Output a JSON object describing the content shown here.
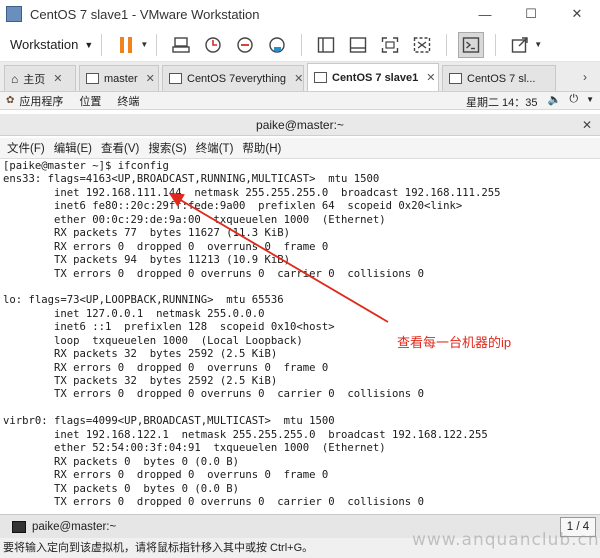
{
  "window": {
    "title": "CentOS 7  slave1 - VMware Workstation",
    "minimize": "—",
    "maximize": "☐",
    "close": "✕"
  },
  "toolbar": {
    "workstation_label": "Workstation"
  },
  "tabs": [
    {
      "label": "主页",
      "icon": "home-icon"
    },
    {
      "label": "master",
      "icon": "vm-icon"
    },
    {
      "label": "CentOS 7everything",
      "icon": "vm-icon"
    },
    {
      "label": "CentOS 7  slave1",
      "icon": "vm-icon",
      "active": true
    },
    {
      "label": "CentOS 7 sl...",
      "icon": "vm-icon"
    }
  ],
  "gnome": {
    "apps": "应用程序",
    "places": "位置",
    "terminal": "终端",
    "clock": "星期二 14：35"
  },
  "terminal": {
    "title": "paike@master:~",
    "menu": [
      "文件(F)",
      "编辑(E)",
      "查看(V)",
      "搜索(S)",
      "终端(T)",
      "帮助(H)"
    ],
    "lines": [
      "[paike@master ~]$ ifconfig",
      "ens33: flags=4163<UP,BROADCAST,RUNNING,MULTICAST>  mtu 1500",
      "        inet 192.168.111.144  netmask 255.255.255.0  broadcast 192.168.111.255",
      "        inet6 fe80::20c:29ff:fede:9a00  prefixlen 64  scopeid 0x20<link>",
      "        ether 00:0c:29:de:9a:00  txqueuelen 1000  (Ethernet)",
      "        RX packets 77  bytes 11627 (11.3 KiB)",
      "        RX errors 0  dropped 0  overruns 0  frame 0",
      "        TX packets 94  bytes 11213 (10.9 KiB)",
      "        TX errors 0  dropped 0 overruns 0  carrier 0  collisions 0",
      "",
      "lo: flags=73<UP,LOOPBACK,RUNNING>  mtu 65536",
      "        inet 127.0.0.1  netmask 255.0.0.0",
      "        inet6 ::1  prefixlen 128  scopeid 0x10<host>",
      "        loop  txqueuelen 1000  (Local Loopback)",
      "        RX packets 32  bytes 2592 (2.5 KiB)",
      "        RX errors 0  dropped 0  overruns 0  frame 0",
      "        TX packets 32  bytes 2592 (2.5 KiB)",
      "        TX errors 0  dropped 0 overruns 0  carrier 0  collisions 0",
      "",
      "virbr0: flags=4099<UP,BROADCAST,MULTICAST>  mtu 1500",
      "        inet 192.168.122.1  netmask 255.255.255.0  broadcast 192.168.122.255",
      "        ether 52:54:00:3f:04:91  txqueuelen 1000  (Ethernet)",
      "        RX packets 0  bytes 0 (0.0 B)",
      "        RX errors 0  dropped 0  overruns 0  frame 0",
      "        TX packets 0  bytes 0 (0.0 B)",
      "        TX errors 0  dropped 0 overruns 0  carrier 0  collisions 0"
    ]
  },
  "annotation": {
    "text": "查看每一台机器的ip",
    "color": "#e0281c"
  },
  "taskbar": {
    "item": "paike@master:~",
    "pager": "1 / 4"
  },
  "statusbar": {
    "text": "要将输入定向到该虚拟机，请将鼠标指针移入其中或按 Ctrl+G。"
  },
  "watermark": "www.anquanclub.cn"
}
